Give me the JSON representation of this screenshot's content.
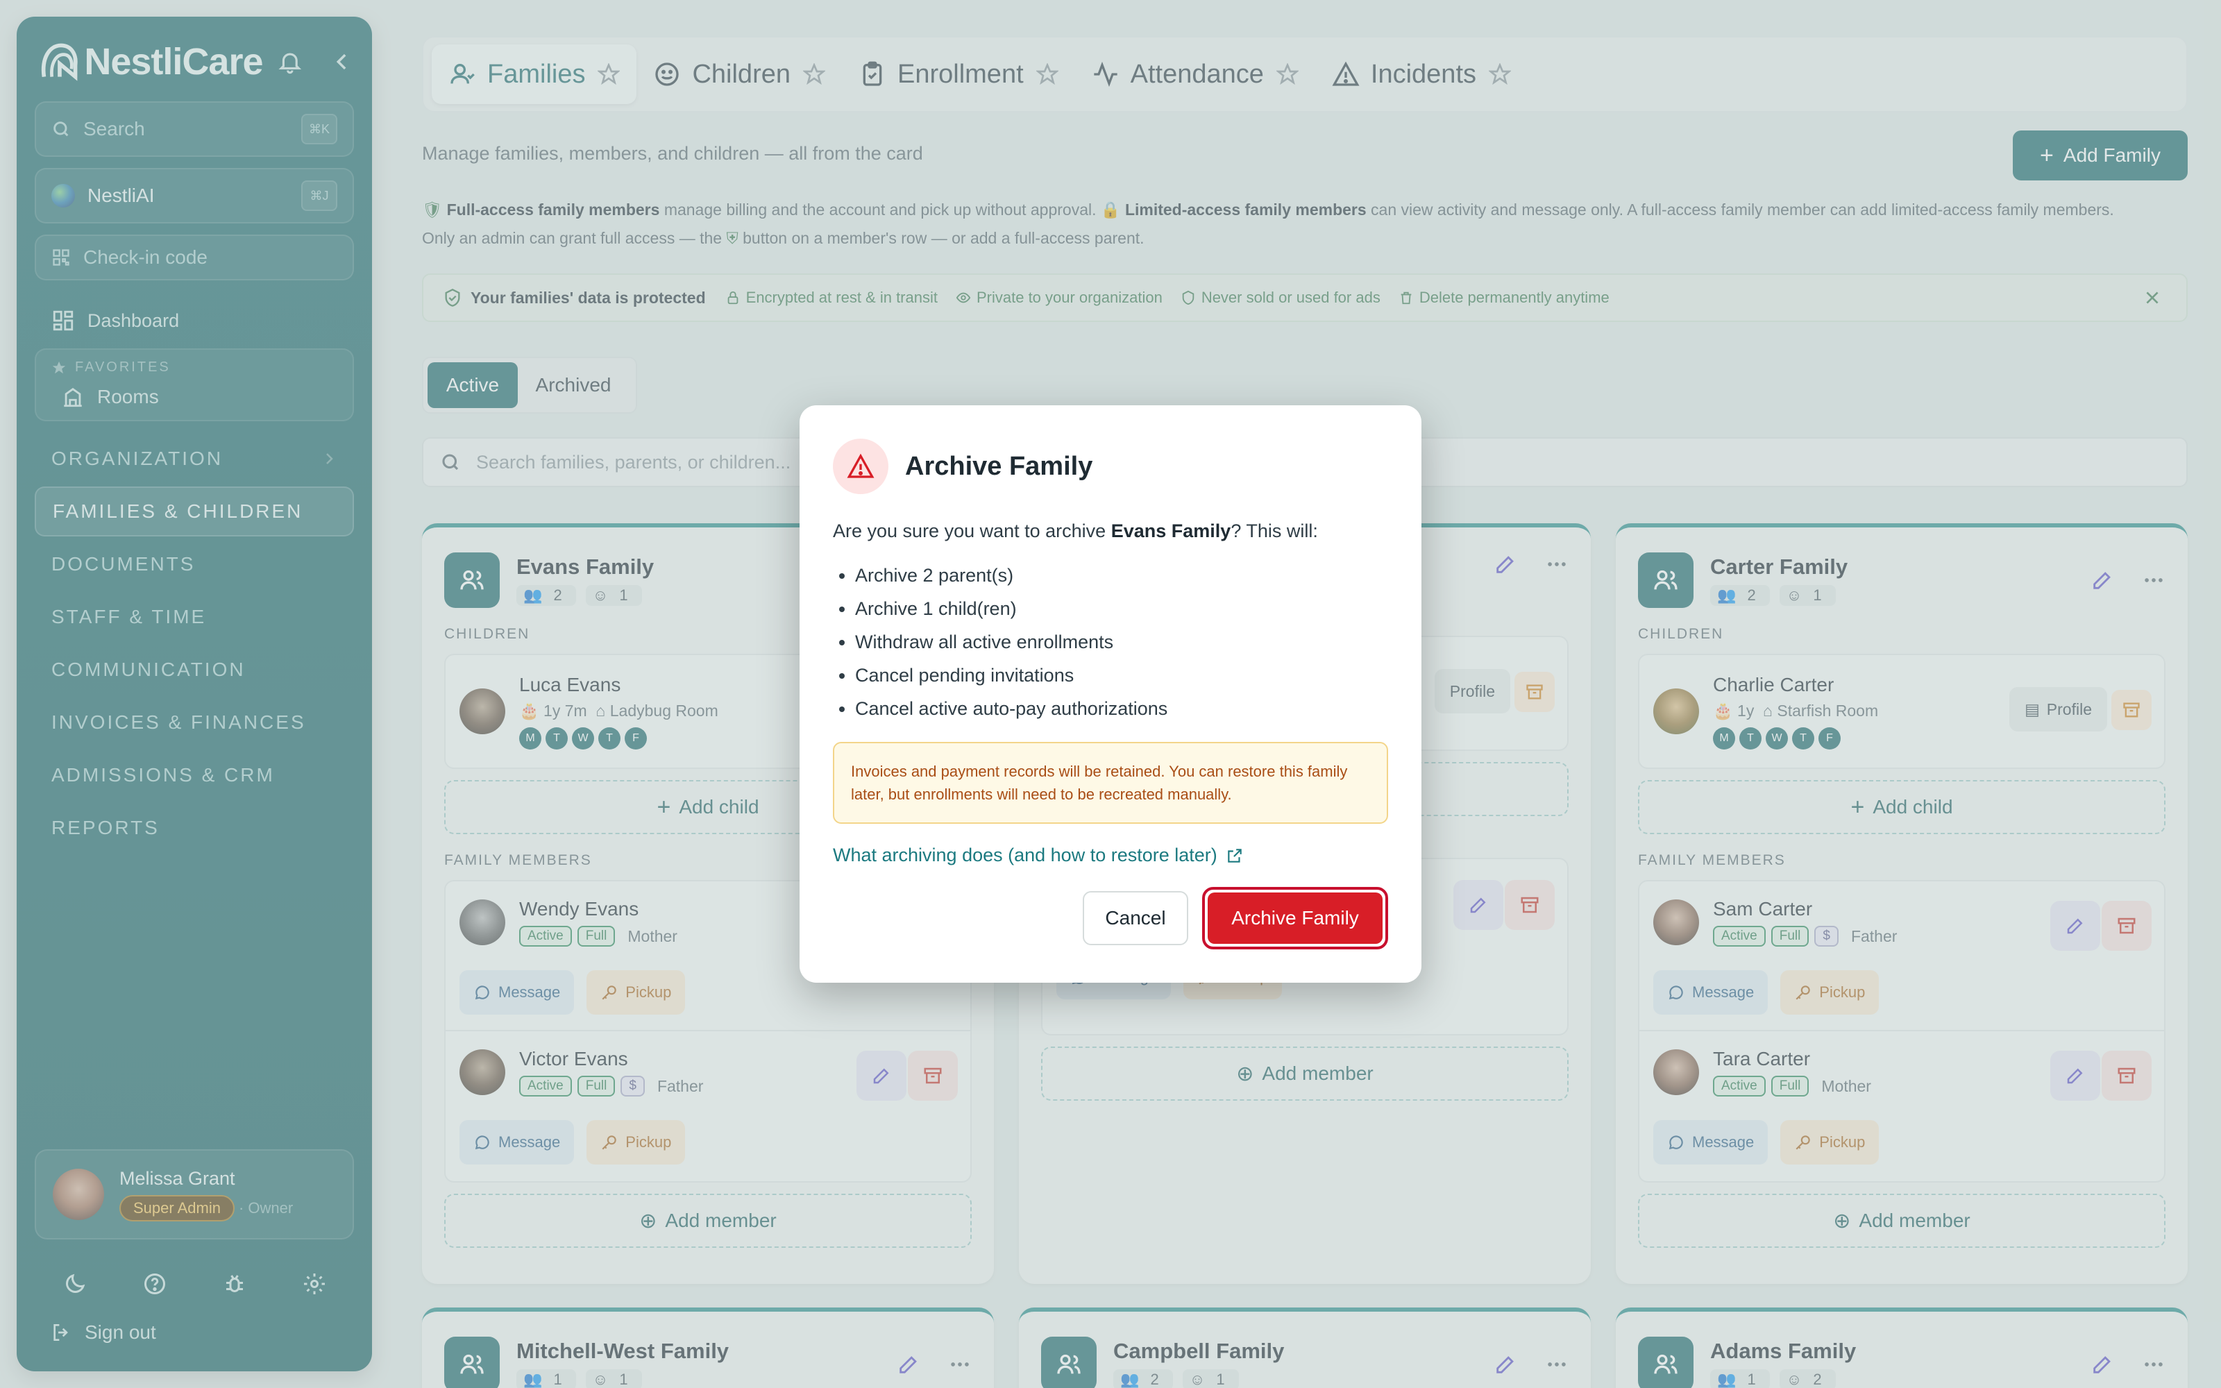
{
  "sidebar": {
    "brand": "NestliCare",
    "search_placeholder": "Search",
    "search_kbd": "⌘K",
    "ai_label": "NestliAI",
    "ai_kbd": "⌘J",
    "checkin_placeholder": "Check-in code",
    "dashboard": "Dashboard",
    "favorites_head": "FAVORITES",
    "favorites": [
      "Rooms"
    ],
    "sections": [
      "ORGANIZATION",
      "FAMILIES & CHILDREN",
      "DOCUMENTS",
      "STAFF & TIME",
      "COMMUNICATION",
      "INVOICES & FINANCES",
      "ADMISSIONS & CRM",
      "REPORTS"
    ],
    "active_section": "FAMILIES & CHILDREN",
    "user": {
      "name": "Melissa Grant",
      "role": "Super Admin",
      "owner": "· Owner"
    },
    "signout": "Sign out"
  },
  "tabs": [
    {
      "label": "Families",
      "icon": "user-icon",
      "active": true
    },
    {
      "label": "Children",
      "icon": "smile-icon",
      "active": false
    },
    {
      "label": "Enrollment",
      "icon": "clipboard-icon",
      "active": false
    },
    {
      "label": "Attendance",
      "icon": "activity-icon",
      "active": false
    },
    {
      "label": "Incidents",
      "icon": "warning-icon",
      "active": false
    }
  ],
  "page": {
    "subtitle": "Manage families, members, and children — all from the card",
    "add_family": "Add Family",
    "info_full_bold": "Full-access family members",
    "info_full_rest": "manage billing and the account and pick up without approval.",
    "info_limited_bold": "Limited-access family members",
    "info_limited_rest": "can view activity and message only. A full-access family member can add limited-access family members.",
    "info_line2_a": "Only an admin can grant full access — the",
    "info_line2_b": "button on a member's row — or add a full-access parent.",
    "protected_title": "Your families' data is protected",
    "protected_items": [
      "Encrypted at rest & in transit",
      "Private to your organization",
      "Never sold or used for ads",
      "Delete permanently anytime"
    ],
    "toggle": {
      "active": "Active",
      "archived": "Archived"
    },
    "search_placeholder": "Search families, parents, or children..."
  },
  "labels": {
    "children": "CHILDREN",
    "family_members": "FAMILY MEMBERS",
    "add_child": "Add child",
    "add_member": "Add member",
    "profile": "Profile",
    "message": "Message",
    "pickup": "Pickup",
    "active": "Active",
    "full": "Full",
    "dollar": "$"
  },
  "cards": {
    "evans": {
      "name": "Evans Family",
      "parents": "2",
      "children": "1",
      "child": {
        "name": "Luca Evans",
        "age": "1y 7m",
        "room": "Ladybug Room",
        "days": [
          "M",
          "T",
          "W",
          "T",
          "F"
        ]
      },
      "members": [
        {
          "name": "Wendy Evans",
          "relation": "Mother"
        },
        {
          "name": "Victor Evans",
          "relation": "Father"
        }
      ]
    },
    "carter": {
      "name": "Carter Family",
      "parents": "2",
      "children": "1",
      "child": {
        "name": "Charlie Carter",
        "age": "1y",
        "room": "Starfish Room",
        "days": [
          "M",
          "T",
          "W",
          "T",
          "F"
        ]
      },
      "members": [
        {
          "name": "Sam Carter",
          "relation": "Father"
        },
        {
          "name": "Tara Carter",
          "relation": "Mother"
        }
      ]
    },
    "bottom": [
      {
        "name": "Mitchell-West Family",
        "parents": "1",
        "children": "1"
      },
      {
        "name": "Campbell Family",
        "parents": "2",
        "children": "1"
      },
      {
        "name": "Adams Family",
        "parents": "1",
        "children": "2"
      }
    ]
  },
  "modal": {
    "title": "Archive Family",
    "question_pre": "Are you sure you want to archive",
    "family": "Evans Family",
    "question_post": "? This will:",
    "items": [
      "Archive 2 parent(s)",
      "Archive 1 child(ren)",
      "Withdraw all active enrollments",
      "Cancel pending invitations",
      "Cancel active auto-pay authorizations"
    ],
    "notice": "Invoices and payment records will be retained. You can restore this family later, but enrollments will need to be recreated manually.",
    "link": "What archiving does (and how to restore later)",
    "cancel": "Cancel",
    "confirm": "Archive Family"
  },
  "colors": {
    "brand": "#1f6b6e",
    "danger": "#d81e27",
    "warning_bg": "#fef9e6"
  }
}
